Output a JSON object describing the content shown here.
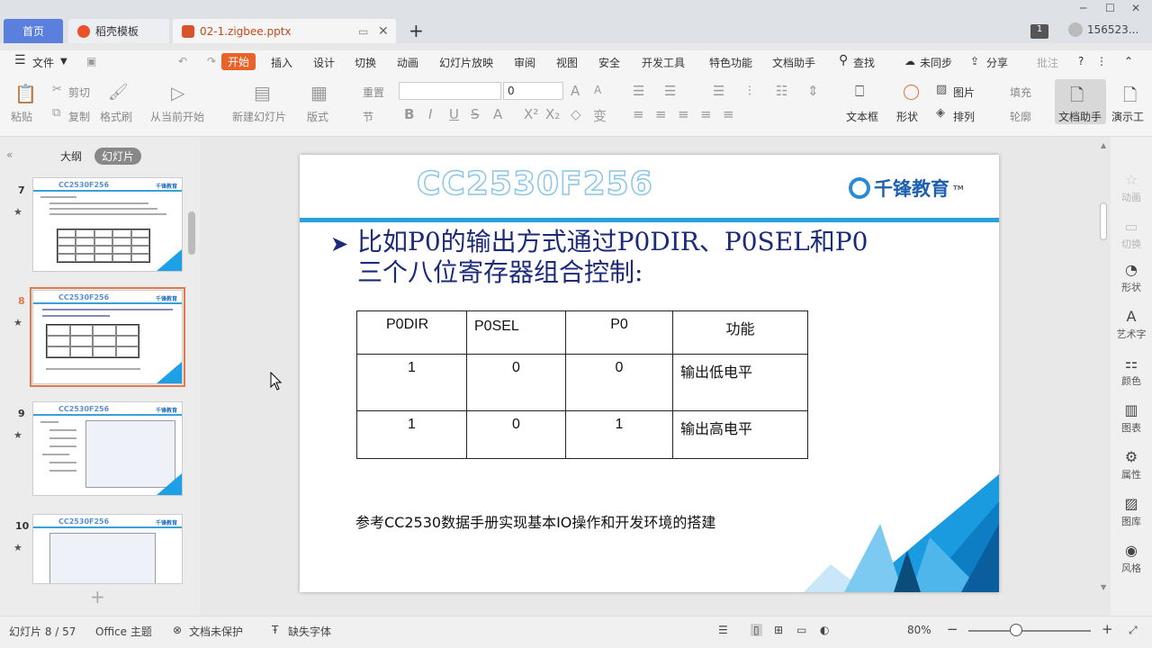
{
  "tabs": {
    "home": "首页",
    "template": "稻壳模板",
    "file": "02-1.zigbee.pptx",
    "add": "+"
  },
  "titlebar": {
    "window_count": "1",
    "user": "156523..."
  },
  "menu": {
    "file": "文件",
    "items": [
      "开始",
      "插入",
      "设计",
      "切换",
      "动画",
      "幻灯片放映",
      "审阅",
      "视图",
      "安全",
      "开发工具",
      "特色功能",
      "文档助手"
    ],
    "search": "查找",
    "sync": "未同步",
    "share": "分享",
    "comment": "批注"
  },
  "toolbar": {
    "paste": "粘贴",
    "cut": "剪切",
    "copy": "复制",
    "format_painter": "格式刷",
    "from_current": "从当前开始",
    "new_slide": "新建幻灯片",
    "layout": "版式",
    "reset": "重置",
    "section": "节",
    "font_size": "0",
    "textbox": "文本框",
    "shape": "形状",
    "picture": "图片",
    "fill": "填充",
    "arrange": "排列",
    "outline": "轮廓",
    "doc_assistant": "文档助手",
    "present": "演示工"
  },
  "left_panel": {
    "tab_outline": "大纲",
    "tab_slides": "幻灯片",
    "slides": [
      {
        "num": "7",
        "title": "CC2530F256"
      },
      {
        "num": "8",
        "title": "CC2530F256"
      },
      {
        "num": "9",
        "title": "CC2530F256"
      },
      {
        "num": "10",
        "title": "CC2530F256"
      }
    ],
    "add": "+"
  },
  "slide": {
    "title": "CC2530F256",
    "logo": "千锋教育",
    "logo_tm": "TM",
    "bullet_line1": "比如P0的输出方式通过P0DIR、P0SEL和P0",
    "bullet_line2": "三个八位寄存器组合控制:",
    "table": {
      "headers": [
        "P0DIR",
        "P0SEL",
        "P0",
        "功能"
      ],
      "rows": [
        [
          "1",
          "0",
          "0",
          "输出低电平"
        ],
        [
          "1",
          "0",
          "1",
          "输出高电平"
        ]
      ]
    },
    "note": "参考CC2530数据手册实现基本IO操作和开发环境的搭建"
  },
  "right_panel": {
    "items": [
      "动画",
      "切换",
      "形状",
      "艺术字",
      "颜色",
      "图表",
      "属性",
      "图库",
      "风格"
    ]
  },
  "status": {
    "slide_info": "幻灯片 8 / 57",
    "theme": "Office 主题",
    "protect": "文档未保护",
    "missing_font": "缺失字体",
    "zoom": "80%"
  }
}
